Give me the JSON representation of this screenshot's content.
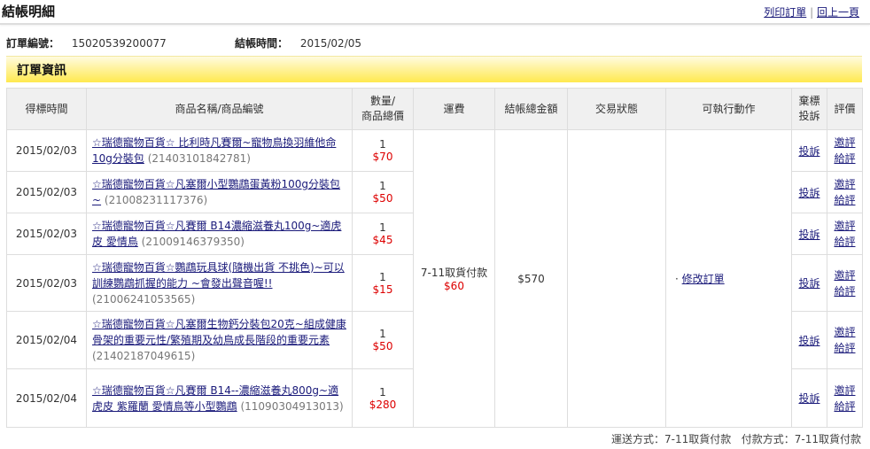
{
  "header": {
    "title": "結帳明細",
    "print_link": "列印訂單",
    "separator": "|",
    "back_link": "回上一頁"
  },
  "order": {
    "number_label": "訂單編號：",
    "number": "15020539200077",
    "time_label": "結帳時間：",
    "time": "2015/02/05"
  },
  "section_title": "訂單資訊",
  "columns": [
    "得標時間",
    "商品名稱/商品編號",
    "數量/\n商品總價",
    "運費",
    "結帳總金額",
    "交易狀態",
    "可執行動作",
    "棄標\n投訴",
    "評價"
  ],
  "rows": [
    {
      "date": "2015/02/03",
      "name": "☆瑞德寵物百貨☆ 比利時凡賽爾~寵物鳥換羽維他命10g分裝包",
      "code": "(21403101842781)",
      "qty": "1",
      "price": "$70"
    },
    {
      "date": "2015/02/03",
      "name": "☆瑞德寵物百貨☆凡塞爾小型鸚鵡蛋黃粉100g分裝包~",
      "code": "(21008231117376)",
      "qty": "1",
      "price": "$50"
    },
    {
      "date": "2015/02/03",
      "name": "☆瑞德寵物百貨☆凡賽爾 B14濃縮滋養丸100g~適虎皮 愛情鳥",
      "code": "(21009146379350)",
      "qty": "1",
      "price": "$45"
    },
    {
      "date": "2015/02/03",
      "name": "☆瑞德寵物百貨☆鸚鵡玩具球(隨機出貨 不挑色)~可以訓練鸚鵡抓握的能力 ~會發出聲音喔!!",
      "code": "(21006241053565)",
      "qty": "1",
      "price": "$15"
    },
    {
      "date": "2015/02/04",
      "name": "☆瑞德寵物百貨☆凡塞爾生物鈣分裝包20克~組成健康骨架的重要元性/繁殖期及幼鳥成長階段的重要元素",
      "code": "(21402187049615)",
      "qty": "1",
      "price": "$50"
    },
    {
      "date": "2015/02/04",
      "name": "☆瑞德寵物百貨☆凡賽爾 B14--濃縮滋養丸800g~適虎皮 紫羅蘭 愛情鳥等小型鸚鵡",
      "code": "(11090304913013)",
      "qty": "1",
      "price": "$280"
    }
  ],
  "shipping": {
    "method": "7-11取貨付款",
    "fee": "$60"
  },
  "total": "$570",
  "status": "",
  "action": "修改訂單",
  "complaint_link": "投訴",
  "review_links": {
    "invite": "邀評",
    "give": "給評"
  },
  "footer": {
    "shipping_label": "運送方式：",
    "shipping": "7-11取貨付款",
    "payment_label": "付款方式：",
    "payment": "7-11取貨付款"
  },
  "colors": {
    "price": "#dd0000",
    "bar": "#ffe94f",
    "link": "#1a1a7a"
  }
}
